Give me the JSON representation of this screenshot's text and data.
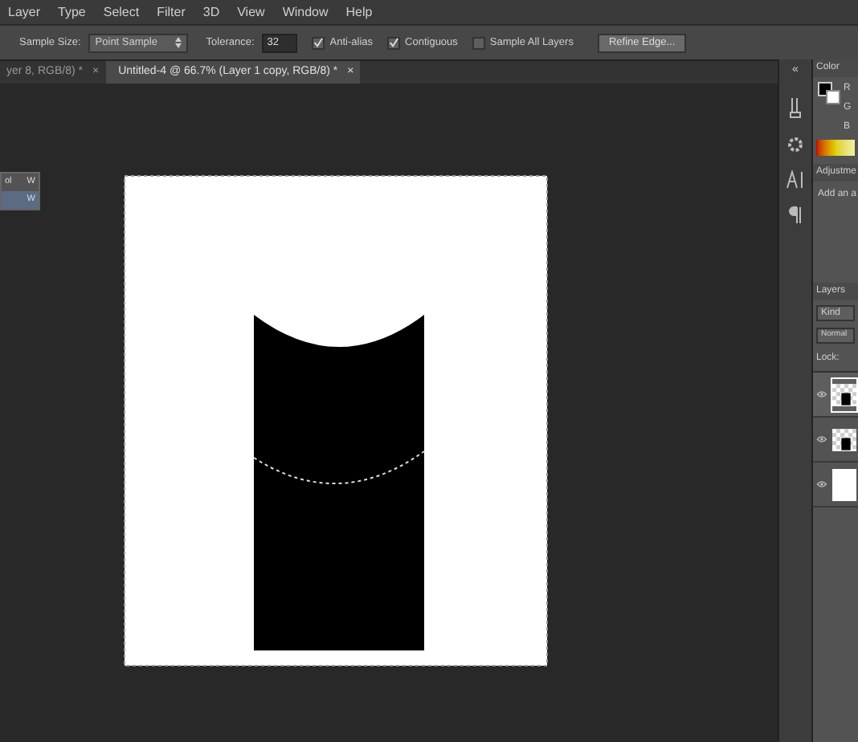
{
  "menu": [
    "Layer",
    "Type",
    "Select",
    "Filter",
    "3D",
    "View",
    "Window",
    "Help"
  ],
  "options": {
    "sample_size_label": "Sample Size:",
    "sample_size": "Point Sample",
    "tolerance_label": "Tolerance:",
    "tolerance": "32",
    "checks": [
      {
        "label": "Anti-alias",
        "checked": true
      },
      {
        "label": "Contiguous",
        "checked": true
      },
      {
        "label": "Sample All Layers",
        "checked": false
      }
    ],
    "refine_button": "Refine Edge..."
  },
  "tabs": [
    {
      "label": "yer 8, RGB/8) *",
      "close": "×",
      "selected": false
    },
    {
      "label": "Untitled-4 @ 66.7% (Layer 1 copy, RGB/8) *",
      "close": "×",
      "selected": true
    }
  ],
  "tool_flyout": [
    {
      "label": "ol",
      "shortcut": "W",
      "selected": false
    },
    {
      "shortcut": "W",
      "selected": true
    }
  ],
  "dock_toggle": "«",
  "color_panel": {
    "tab": "Color",
    "channels": [
      "R",
      "G",
      "B"
    ]
  },
  "adjustments_panel": {
    "tab": "Adjustme",
    "hint": "Add an a"
  },
  "layers_panel": {
    "tab": "Layers",
    "filter": "Kind",
    "blend_mode": "Normal",
    "lock_label": "Lock:",
    "layers": [
      {
        "kind": "checker",
        "visible": true,
        "selected": true
      },
      {
        "kind": "checker",
        "visible": true,
        "selected": false
      },
      {
        "kind": "white",
        "visible": true,
        "selected": false
      }
    ]
  }
}
